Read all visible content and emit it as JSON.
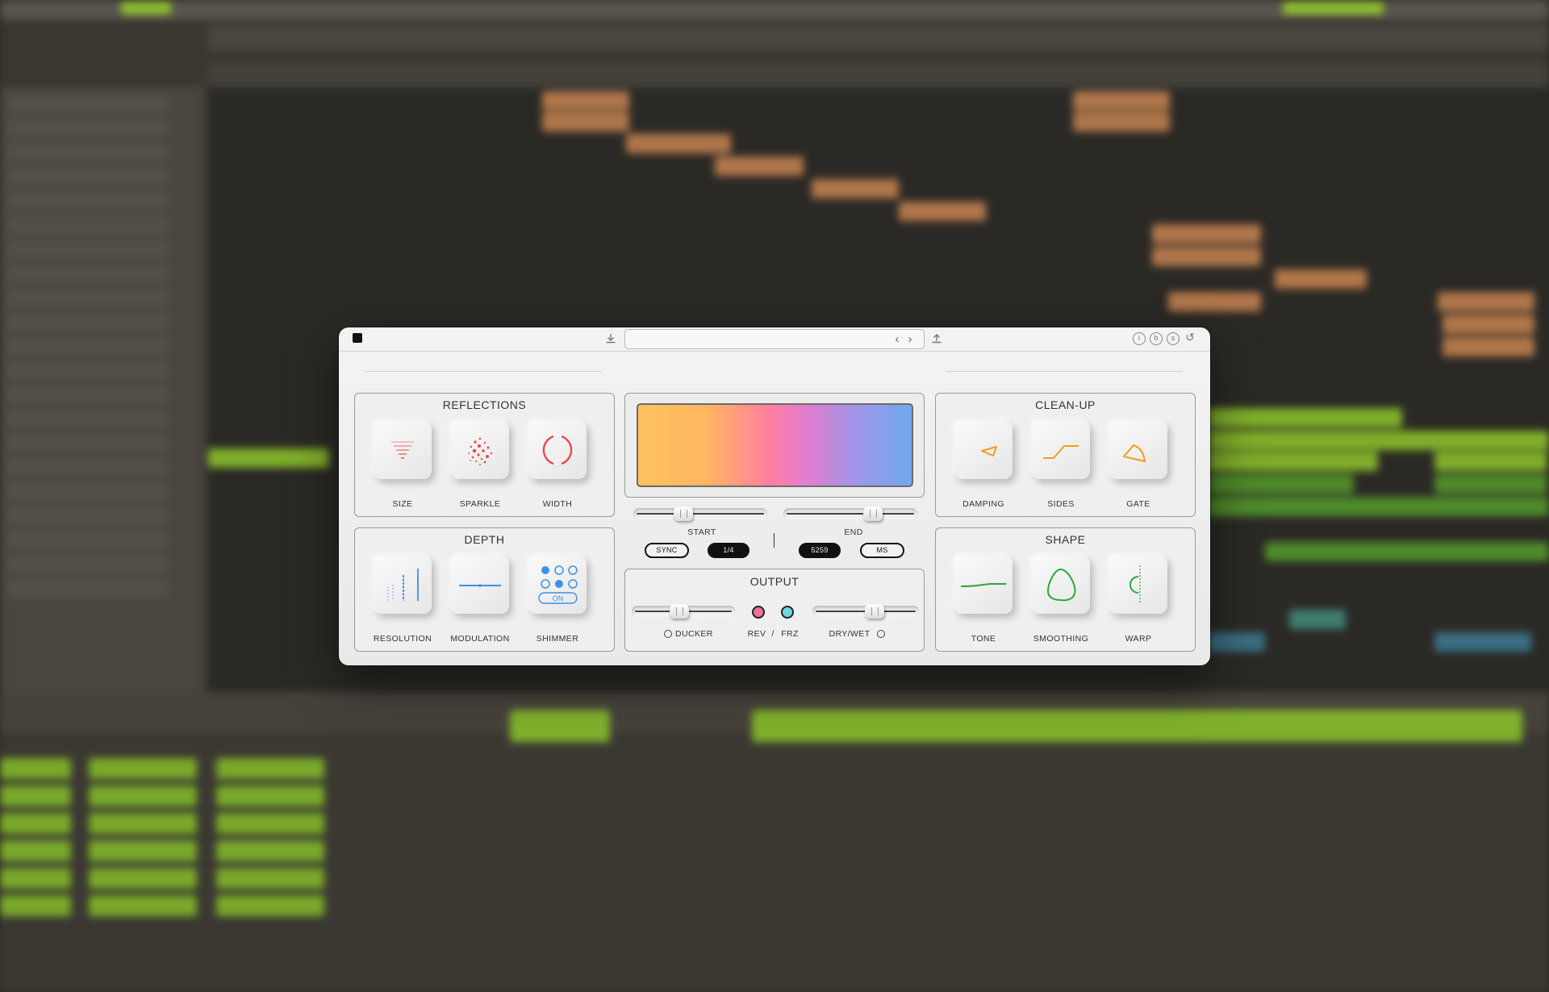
{
  "colors": {
    "accent_red": "#e84a4a",
    "accent_blue": "#3f8fe8",
    "accent_orange": "#f0a018",
    "accent_green": "#2aa83a",
    "led_pink": "#f0709a",
    "led_cyan": "#6fd8df"
  },
  "titlebar": {
    "logo_icon": "square-logo-icon",
    "download_icon": "download-icon",
    "preset_value": "",
    "prev_glyph": "‹",
    "next_glyph": "›",
    "upload_icon": "upload-icon",
    "info_glyph": "i",
    "b_glyph": "b",
    "save_glyph": "s",
    "reset_glyph": "↺"
  },
  "reflections": {
    "title": "REFLECTIONS",
    "buttons": [
      {
        "label": "SIZE",
        "icon": "size-icon"
      },
      {
        "label": "SPARKLE",
        "icon": "sparkle-icon"
      },
      {
        "label": "WIDTH",
        "icon": "width-icon"
      }
    ]
  },
  "depth": {
    "title": "DEPTH",
    "buttons": [
      {
        "label": "RESOLUTION",
        "icon": "resolution-icon"
      },
      {
        "label": "MODULATION",
        "icon": "modulation-icon"
      },
      {
        "label": "SHIMMER",
        "icon": "shimmer-icon",
        "badge": "ON"
      }
    ]
  },
  "cleanup": {
    "title": "CLEAN-UP",
    "buttons": [
      {
        "label": "DAMPING",
        "icon": "damping-icon"
      },
      {
        "label": "SIDES",
        "icon": "sides-icon"
      },
      {
        "label": "GATE",
        "icon": "gate-icon"
      }
    ]
  },
  "shape": {
    "title": "SHAPE",
    "buttons": [
      {
        "label": "TONE",
        "icon": "tone-icon"
      },
      {
        "label": "SMOOTHING",
        "icon": "smoothing-icon"
      },
      {
        "label": "WARP",
        "icon": "warp-icon"
      }
    ]
  },
  "center": {
    "start_label": "START",
    "end_label": "END",
    "start_value": 0.35,
    "end_value": 0.7,
    "sync_label": "SYNC",
    "division_value": "1/4",
    "time_value": "5259",
    "unit_label": "MS"
  },
  "output": {
    "title": "OUTPUT",
    "ducker_label": "DUCKER",
    "rev_label": "REV",
    "slash": "/",
    "frz_label": "FRZ",
    "drywet_label": "DRY/WET",
    "ducker_value": 0.45,
    "drywet_value": 0.6
  }
}
